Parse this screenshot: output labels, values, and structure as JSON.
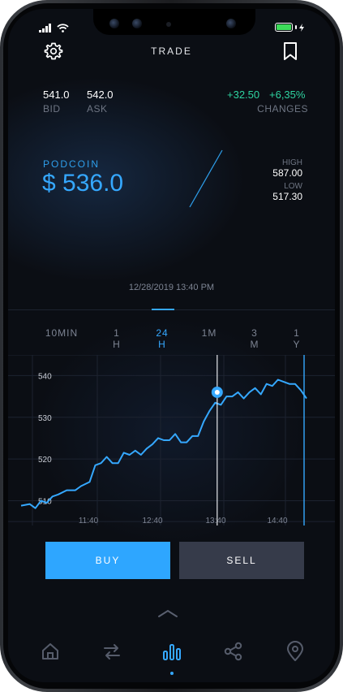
{
  "header": {
    "title": "TRADE"
  },
  "quote": {
    "bid_value": "541.0",
    "bid_label": "BID",
    "ask_value": "542.0",
    "ask_label": "ASK",
    "change_abs": "+32.50",
    "change_pct": "+6,35%",
    "changes_label": "CHANGES"
  },
  "coin": {
    "name": "PODCOIN",
    "price": "$ 536.0",
    "high_label": "HIGH",
    "high_value": "587.00",
    "low_label": "LOW",
    "low_value": "517.30"
  },
  "timestamp": "12/28/2019 13:40 PM",
  "tabs": [
    {
      "line1": "10MIN",
      "line2": ""
    },
    {
      "line1": "1",
      "line2": "H"
    },
    {
      "line1": "24",
      "line2": "H"
    },
    {
      "line1": "1M",
      "line2": ""
    },
    {
      "line1": "3",
      "line2": "M"
    },
    {
      "line1": "1",
      "line2": "Y"
    }
  ],
  "active_tab": "24 H",
  "chart_data": {
    "type": "line",
    "y_ticks": [
      "540",
      "530",
      "520",
      "510"
    ],
    "x_ticks": [
      "11:40",
      "12:40",
      "13:40",
      "14:40"
    ],
    "ylim": [
      506,
      543
    ],
    "series": [
      {
        "values": [
          [
            0.0,
            508.8
          ],
          [
            0.03,
            509.2
          ],
          [
            0.05,
            508.2
          ],
          [
            0.07,
            510.0
          ],
          [
            0.09,
            509.5
          ],
          [
            0.11,
            511.0
          ],
          [
            0.13,
            511.5
          ],
          [
            0.16,
            512.5
          ],
          [
            0.19,
            512.5
          ],
          [
            0.21,
            513.5
          ],
          [
            0.24,
            514.5
          ],
          [
            0.26,
            518.5
          ],
          [
            0.28,
            519.0
          ],
          [
            0.3,
            520.5
          ],
          [
            0.32,
            519.0
          ],
          [
            0.34,
            519.0
          ],
          [
            0.36,
            521.5
          ],
          [
            0.38,
            521.0
          ],
          [
            0.4,
            522.0
          ],
          [
            0.42,
            521.0
          ],
          [
            0.44,
            522.5
          ],
          [
            0.46,
            523.5
          ],
          [
            0.48,
            525.0
          ],
          [
            0.5,
            524.5
          ],
          [
            0.52,
            524.5
          ],
          [
            0.54,
            526.0
          ],
          [
            0.56,
            524.0
          ],
          [
            0.58,
            524.0
          ],
          [
            0.6,
            525.5
          ],
          [
            0.62,
            525.5
          ],
          [
            0.64,
            529.0
          ],
          [
            0.66,
            531.5
          ],
          [
            0.68,
            533.5
          ],
          [
            0.7,
            533.0
          ],
          [
            0.72,
            535.0
          ],
          [
            0.74,
            535.0
          ],
          [
            0.76,
            536.0
          ],
          [
            0.78,
            534.5
          ],
          [
            0.8,
            536.0
          ],
          [
            0.82,
            537.0
          ],
          [
            0.84,
            535.5
          ],
          [
            0.86,
            538.0
          ],
          [
            0.88,
            537.5
          ],
          [
            0.9,
            539.0
          ],
          [
            0.92,
            538.5
          ],
          [
            0.94,
            538.0
          ],
          [
            0.96,
            538.0
          ],
          [
            0.98,
            536.5
          ],
          [
            1.0,
            534.5
          ]
        ]
      }
    ],
    "marker": [
      0.687,
      536.0
    ],
    "grid": true
  },
  "actions": {
    "buy_label": "BUY",
    "sell_label": "SELL"
  },
  "nav": [
    "home-icon",
    "transfer-icon",
    "chart-icon",
    "share-icon",
    "location-icon"
  ],
  "colors": {
    "accent": "#35a8ff",
    "positive": "#2ed3a0",
    "buy": "#2ea6ff",
    "sell": "#363b4a"
  }
}
